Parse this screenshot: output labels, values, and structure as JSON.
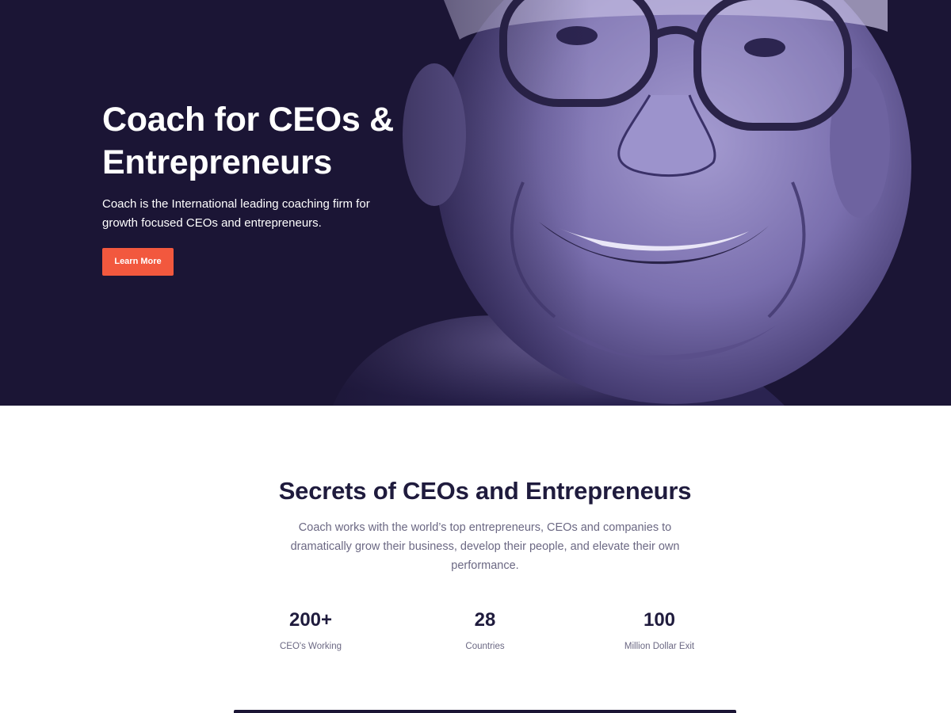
{
  "hero": {
    "title_line1": "Coach for CEOs &",
    "title_line2": "Entrepreneurs",
    "subtitle": "Coach is the International leading coaching firm for growth focused CEOs and entrepreneurs.",
    "cta_label": "Learn More",
    "image_description": "portrait-of-smiling-man-with-glasses",
    "overlay_color": "#1b1535",
    "accent_color": "#f2583e"
  },
  "secrets": {
    "title": "Secrets of CEOs and Entrepreneurs",
    "description": "Coach works with the world’s top entrepreneurs, CEOs and companies to dramatically grow their business, develop their people, and elevate their own performance."
  },
  "stats": [
    {
      "value": "200+",
      "label": "CEO's Working"
    },
    {
      "value": "28",
      "label": "Countries"
    },
    {
      "value": "100",
      "label": "Million Dollar Exit"
    }
  ]
}
